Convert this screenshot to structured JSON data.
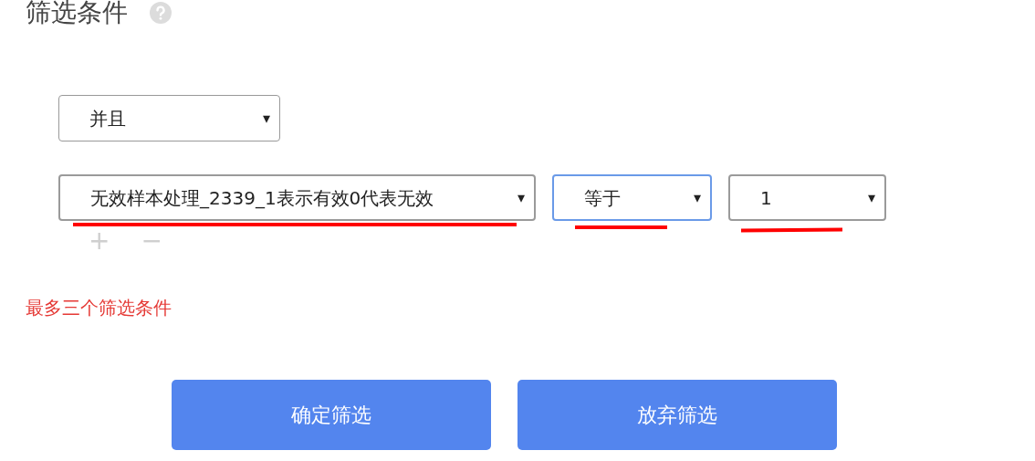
{
  "title": "筛选条件",
  "logic_select": {
    "value": "并且",
    "arrow": "▾"
  },
  "condition": {
    "field": {
      "value": "无效样本处理_2339_1表示有效0代表无效",
      "arrow": "▾",
      "focused": false
    },
    "operator": {
      "value": "等于",
      "arrow": "▾",
      "focused": true
    },
    "target": {
      "value": "1",
      "arrow": "▾",
      "focused": false
    }
  },
  "row_actions": [
    "+",
    "−"
  ],
  "warning": "最多三个筛选条件",
  "buttons": [
    "确定筛选",
    "放弃筛选"
  ]
}
